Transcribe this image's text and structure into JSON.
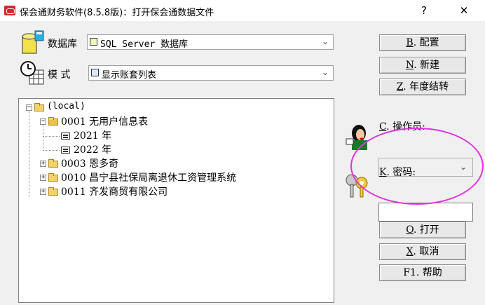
{
  "window": {
    "title": "保会通财务软件(8.5.8版)：打开保会通数据文件",
    "help_glyph": "?",
    "close_glyph": "✕"
  },
  "database": {
    "label": "数据库",
    "value": "SQL Server 数据库"
  },
  "mode": {
    "label": "模  式",
    "value": "显示账套列表"
  },
  "tree": {
    "root": "(local)",
    "n0001": "0001  无用户信息表",
    "y2021": "2021 年",
    "y2022": "2022 年",
    "n0003": "0003  恩多奇",
    "n0010": "0010  昌宁县社保局离退休工资管理系统",
    "n0011": "0011  齐发商贸有限公司",
    "collapse_glyph": "−",
    "expand_glyph": "+"
  },
  "buttons": {
    "config": {
      "key": "B",
      "text": ". 配置"
    },
    "new": {
      "key": "N",
      "text": ". 新建"
    },
    "yearend": {
      "key": "Z",
      "text": ". 年度结转"
    },
    "open": {
      "key": "O",
      "text": ". 打开"
    },
    "cancel": {
      "key": "X",
      "text": ". 取消"
    },
    "help": {
      "key": "",
      "text": "F1. 帮助"
    }
  },
  "operator": {
    "key": "C",
    "text": ". 操作员:",
    "value": ""
  },
  "password": {
    "key": "K",
    "text": ". 密码:",
    "value": ""
  },
  "colors": {
    "annotation": "#e033e0",
    "title_icon": "#d42a2a"
  }
}
